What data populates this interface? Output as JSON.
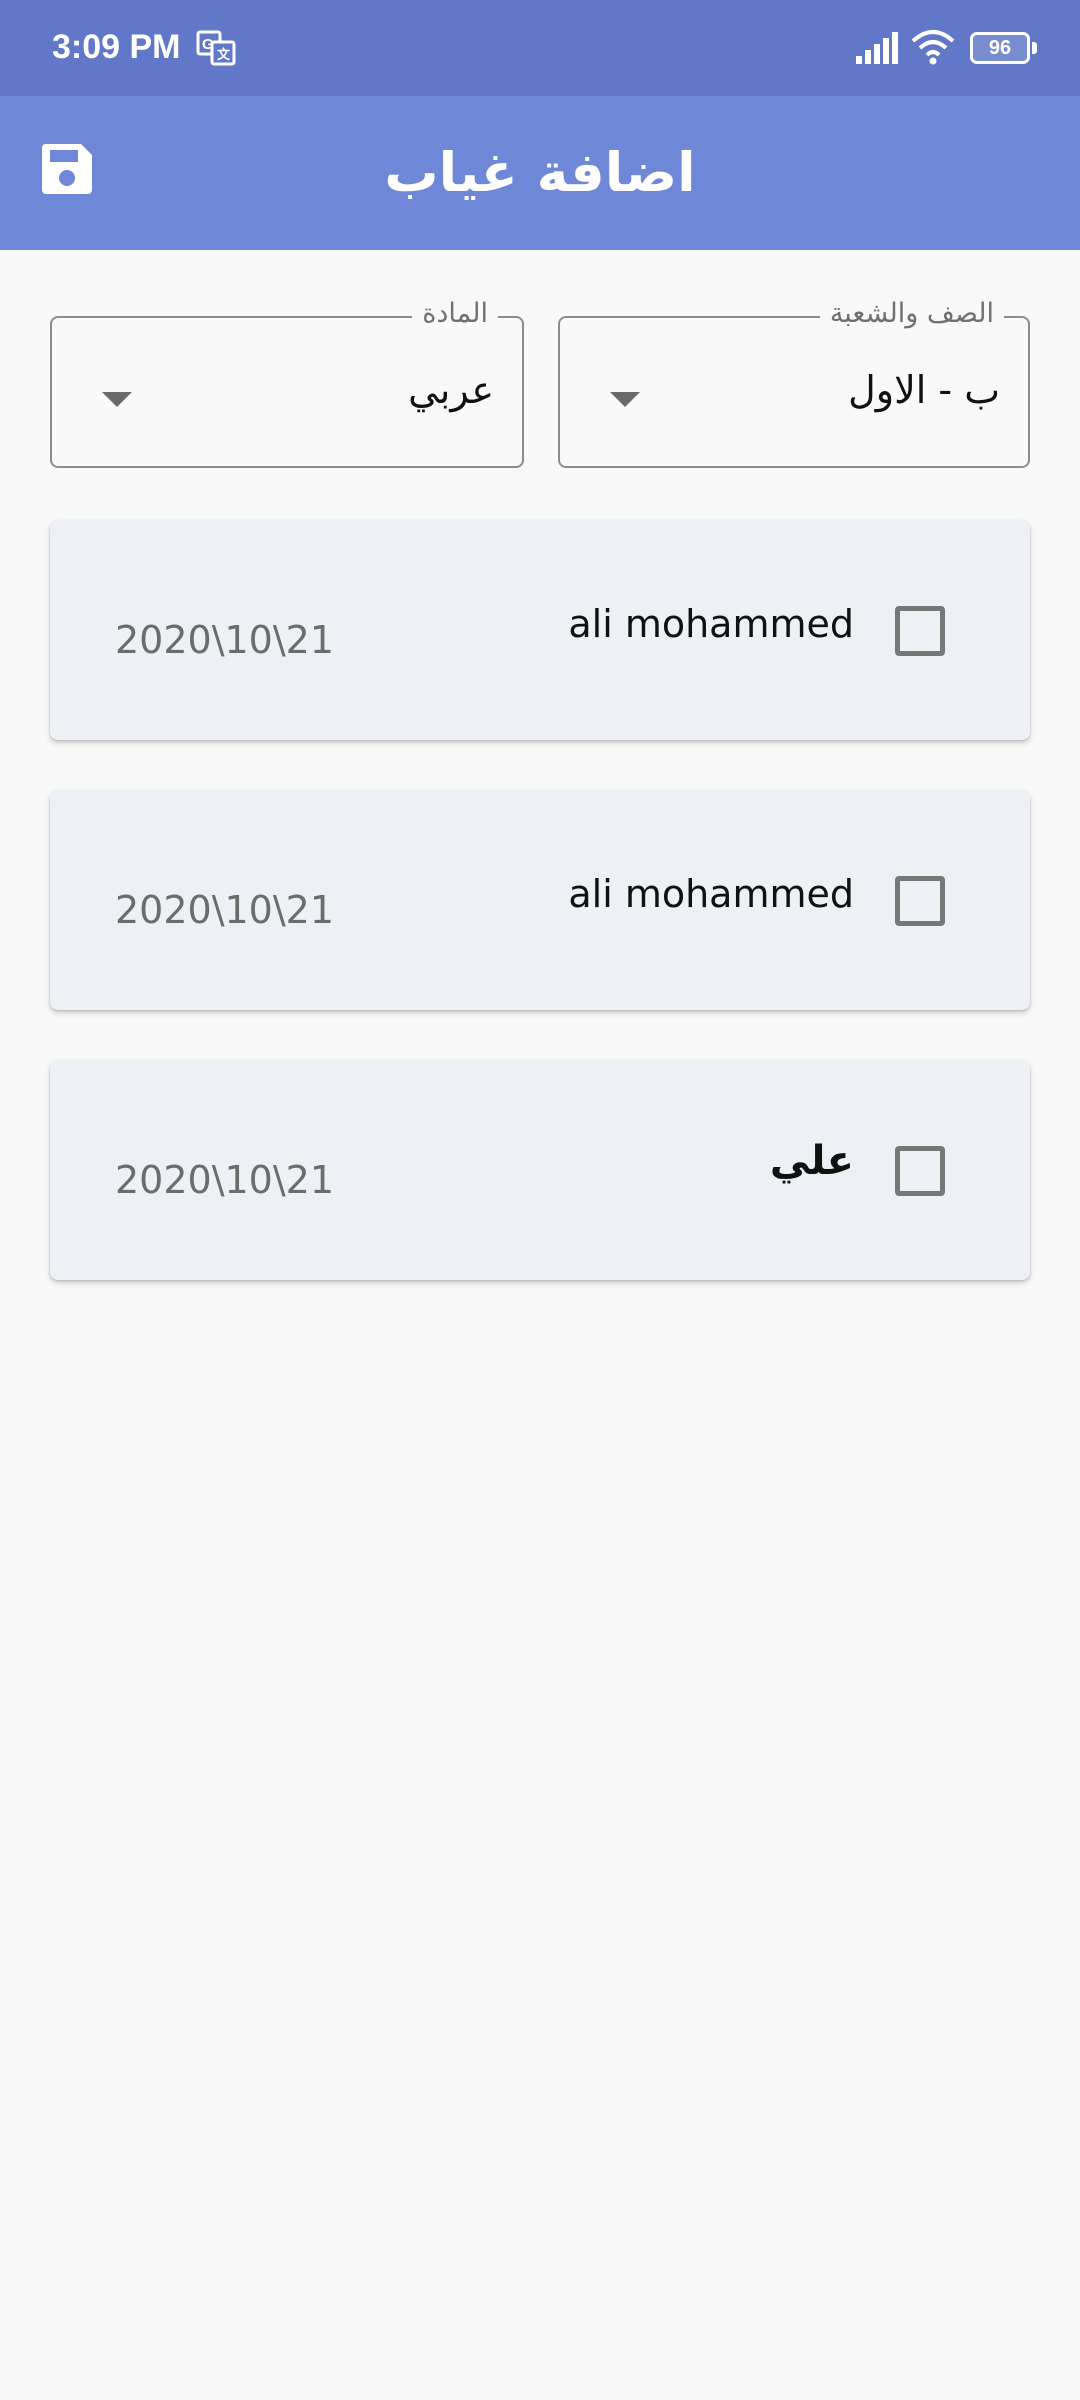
{
  "status_bar": {
    "time": "3:09 PM",
    "battery": "96",
    "icons": [
      "translate-icon",
      "signal-icon",
      "wifi-icon",
      "battery-icon"
    ]
  },
  "app_bar": {
    "title": "اضافة غياب",
    "save_icon": "save-icon",
    "background": "#6e87d6"
  },
  "filters": {
    "subject": {
      "label": "المادة",
      "value": "عربي"
    },
    "class_section": {
      "label": "الصف والشعبة",
      "value": "ب - الاول"
    }
  },
  "students": [
    {
      "name": "ali mohammed",
      "date": "2020\\10\\21",
      "checked": false
    },
    {
      "name": "ali mohammed",
      "date": "2020\\10\\21",
      "checked": false
    },
    {
      "name": "علي",
      "date": "2020\\10\\21",
      "checked": false
    }
  ],
  "colors": {
    "status_bar": "#6178c8",
    "app_bar": "#6e87d6",
    "card": "#edf0f5",
    "background": "#f9f9f9"
  }
}
